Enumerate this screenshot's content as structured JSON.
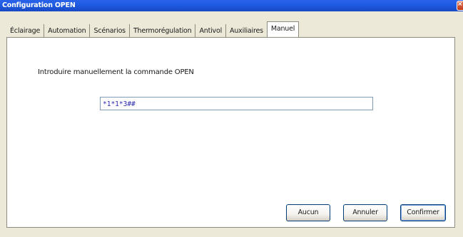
{
  "window": {
    "title": "Configuration OPEN",
    "close_glyph": "×"
  },
  "tabs": [
    {
      "label": "Éclairage",
      "active": false
    },
    {
      "label": "Automation",
      "active": false
    },
    {
      "label": "Scénarios",
      "active": false
    },
    {
      "label": "Thermorégulation",
      "active": false
    },
    {
      "label": "Antivol",
      "active": false
    },
    {
      "label": "Auxiliaires",
      "active": false
    },
    {
      "label": "Manuel",
      "active": true
    }
  ],
  "manual": {
    "prompt": "Introduire manuellement la commande OPEN",
    "command_value": "*1*1*3##"
  },
  "buttons": {
    "aucun": "Aucun",
    "annuler": "Annuler",
    "confirmer": "Confirmer"
  },
  "colors": {
    "titlebar": "#1f5ce3",
    "window_bg": "#ece9d8",
    "panel_bg": "#ffffff",
    "input_text": "#2c2cb0"
  }
}
